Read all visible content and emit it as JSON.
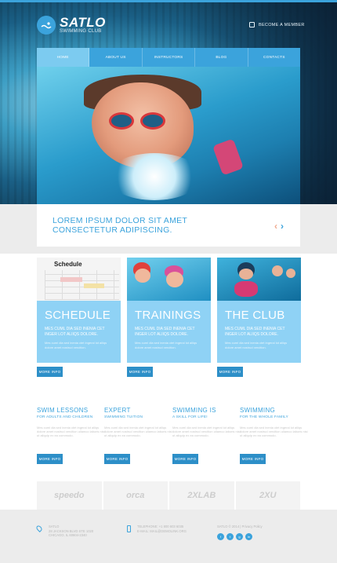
{
  "header": {
    "logo_title": "SATLO",
    "logo_subtitle": "SWIMMING CLUB",
    "member_link": "BECOME A MEMBER"
  },
  "nav": {
    "items": [
      "HOME",
      "ABOUT US",
      "INSTRUCTORS",
      "BLOG",
      "CONTACTS"
    ],
    "active": "HOME"
  },
  "band": {
    "line1": "LOREM IPSUM DOLOR SIT AMET",
    "line2": "CONSECTETUR ADIPISCING."
  },
  "cards": [
    {
      "title": "SCHEDULE",
      "subtitle": "MES CUML DIA SED INENIA CET INGER LOT ALIIQS DOLORE.",
      "text": "Mes cuml dia sed inenia ctet ingeral lot aliiqs dolore amet nostrud xercition.",
      "button": "MORE INFO",
      "image_label": "Schedule"
    },
    {
      "title": "TRAININGS",
      "subtitle": "MES CUML DIA SED INENIA CET INGER LOT ALIIQS DOLORE.",
      "text": "Mes cuml dia sed inenia ctet ingeral lot aliiqs dolore amet nostrud xercition.",
      "button": "MORE INFO"
    },
    {
      "title": "THE CLUB",
      "subtitle": "MES CUML DIA SED INENIA CET INGER LOT ALIIQS DOLORE.",
      "text": "Mes cuml dia sed inenia ctet ingeral lot aliiqs dolore amet nostrud xercition.",
      "button": "MORE INFO"
    }
  ],
  "features": [
    {
      "title": "SWIM LESSONS",
      "subtitle": "FOR ADULTS AND CHILDREN",
      "text": "Mes cuml dia sed inenia ctet ingeral lot aliiqs dolore amet nostrud xercition ullamco laboris nisi ut aliquip ex ea commodo.",
      "button": "MORE INFO"
    },
    {
      "title": "EXPERT",
      "subtitle": "SWIMMING TUITION",
      "text": "Mes cuml dia sed inenia ctet ingeral lot aliiqs dolore amet nostrud xercition ullamco laboris nisi ut aliquip ex ea commodo.",
      "button": "MORE INFO"
    },
    {
      "title": "SWIMMING IS",
      "subtitle": "A SKILL FOR LIFE!",
      "text": "Mes cuml dia sed inenia ctet ingeral lot aliiqs dolore amet nostrud xercition ullamco laboris nisi ut aliquip ex ea commodo.",
      "button": "MORE INFO"
    },
    {
      "title": "SWIMMING",
      "subtitle": "FOR THE WHOLE FAMILY",
      "text": "Mes cuml dia sed inenia ctet ingeral lot aliiqs dolore amet nostrud xercition ullamco laboris nisi ut aliquip ex ea commodo.",
      "button": "MORE INFO"
    }
  ],
  "brands": [
    "speedo",
    "orca",
    "2XLAB",
    "2XU"
  ],
  "footer": {
    "address": [
      "SATLO",
      "28 JACKSON BLVD STE 1020",
      "CHICAGO, IL 60604-2340"
    ],
    "contact": [
      "TELEPHONE: +1 800 603 6035",
      "E-MAIL: MAIL@DEMOLINK.ORG"
    ],
    "copyright": "SATLO © 2014 | Privacy Policy",
    "social": [
      "f",
      "t",
      "g",
      "in"
    ]
  },
  "colors": {
    "accent": "#3ba3dc",
    "card": "#8fd2f5",
    "button": "#2d8fc8"
  }
}
